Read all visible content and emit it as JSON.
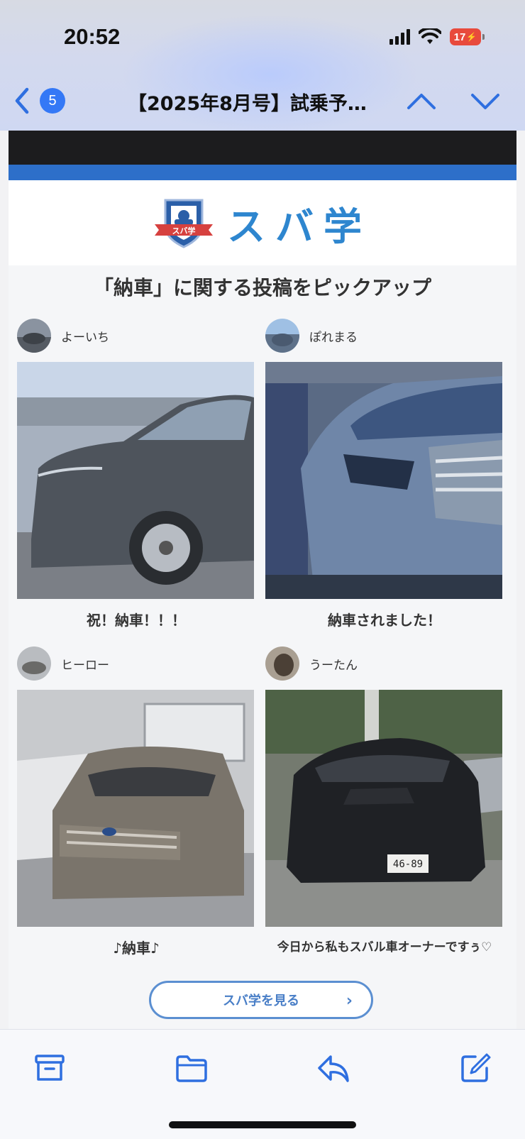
{
  "status_bar": {
    "time": "20:52",
    "battery": "17"
  },
  "nav": {
    "unread_count": "5",
    "title": "【2025年8月号】試乗予…"
  },
  "email": {
    "logo_text": "スバ学",
    "logo_badge": "スバ学",
    "headline": "「納車」に関する投稿をピックアップ",
    "posts": [
      {
        "username": "よーいち",
        "caption": "祝！納車！！！",
        "photo": "gray-subaru-forester-side"
      },
      {
        "username": "ぽれまる",
        "caption": "納車されました！",
        "photo": "blue-gray-subaru-front-closeup"
      },
      {
        "username": "ヒーロー",
        "caption": "♪納車♪",
        "photo": "bronze-subaru-forester-showroom"
      },
      {
        "username": "うーたん",
        "caption": "今日から私もスバル車オーナーですぅ♡",
        "photo": "black-subaru-wrx-parking"
      }
    ],
    "cta_label": "スバ学を見る"
  },
  "colors": {
    "accent": "#3478f6",
    "brand_blue": "#2d6fc9",
    "cta_border": "#5b8fd1"
  },
  "toolbar": {
    "items": [
      "archive-icon",
      "folder-icon",
      "reply-icon",
      "compose-icon"
    ]
  }
}
